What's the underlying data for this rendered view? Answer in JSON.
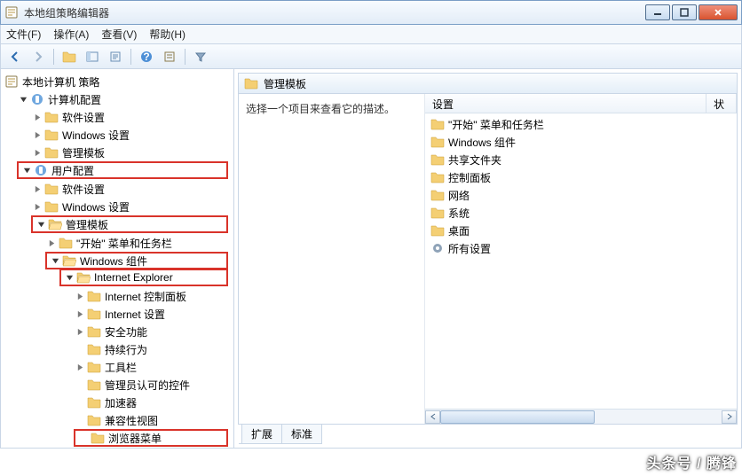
{
  "window": {
    "title": "本地组策略编辑器"
  },
  "menu": {
    "file": "文件(F)",
    "action": "操作(A)",
    "view": "查看(V)",
    "help": "帮助(H)"
  },
  "tree": {
    "root": "本地计算机 策略",
    "computer": "计算机配置",
    "software": "软件设置",
    "windows_settings": "Windows 设置",
    "admin_templates": "管理模板",
    "user": "用户配置",
    "start_taskbar": "\"开始\" 菜单和任务栏",
    "win_components": "Windows 组件",
    "ie": "Internet Explorer",
    "ie_cpanel": "Internet 控制面板",
    "ie_settings": "Internet 设置",
    "security": "安全功能",
    "persist": "持续行为",
    "toolbar": "工具栏",
    "admin_controls": "管理员认可的控件",
    "accel": "加速器",
    "compat": "兼容性视图",
    "browser_menu": "浏览器菜单"
  },
  "content": {
    "title": "管理模板",
    "desc": "选择一个项目来查看它的描述。",
    "col_setting": "设置",
    "col_state": "状",
    "items": {
      "start": "\"开始\" 菜单和任务栏",
      "wincomp": "Windows 组件",
      "shared": "共享文件夹",
      "cpanel": "控制面板",
      "network": "网络",
      "system": "系统",
      "desktop": "桌面",
      "all": "所有设置"
    },
    "tabs": {
      "extended": "扩展",
      "standard": "标准"
    }
  },
  "watermark": "头条号 / 腾锋"
}
